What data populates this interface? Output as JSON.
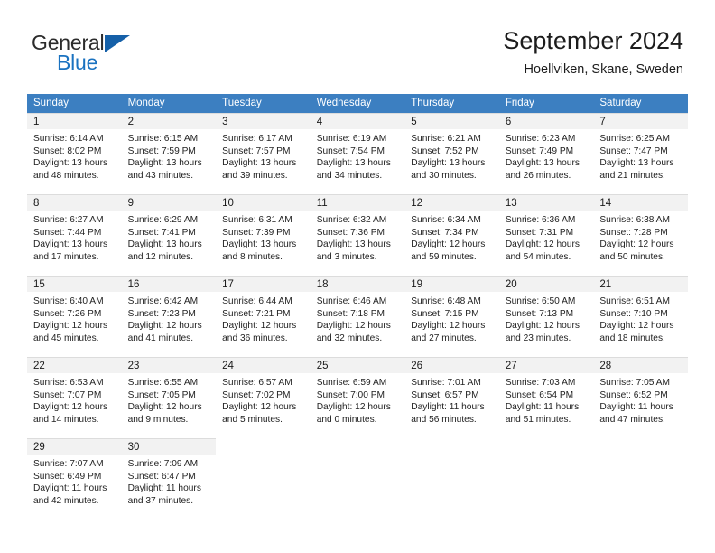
{
  "brand": {
    "name_part1": "General",
    "name_part2": "Blue",
    "flag_icon": "triangle-flag-icon",
    "accent_color": "#1a72c0"
  },
  "header": {
    "month_title": "September 2024",
    "location": "Hoellviken, Skane, Sweden"
  },
  "theme": {
    "header_bg": "#3c7fc1",
    "daynum_bg": "#f2f2f2",
    "grid_line": "#dcdcdc",
    "text": "#1a1a1a"
  },
  "weekday_headers": [
    "Sunday",
    "Monday",
    "Tuesday",
    "Wednesday",
    "Thursday",
    "Friday",
    "Saturday"
  ],
  "weeks": [
    [
      {
        "day": "1",
        "sunrise": "Sunrise: 6:14 AM",
        "sunset": "Sunset: 8:02 PM",
        "daylight1": "Daylight: 13 hours",
        "daylight2": "and 48 minutes."
      },
      {
        "day": "2",
        "sunrise": "Sunrise: 6:15 AM",
        "sunset": "Sunset: 7:59 PM",
        "daylight1": "Daylight: 13 hours",
        "daylight2": "and 43 minutes."
      },
      {
        "day": "3",
        "sunrise": "Sunrise: 6:17 AM",
        "sunset": "Sunset: 7:57 PM",
        "daylight1": "Daylight: 13 hours",
        "daylight2": "and 39 minutes."
      },
      {
        "day": "4",
        "sunrise": "Sunrise: 6:19 AM",
        "sunset": "Sunset: 7:54 PM",
        "daylight1": "Daylight: 13 hours",
        "daylight2": "and 34 minutes."
      },
      {
        "day": "5",
        "sunrise": "Sunrise: 6:21 AM",
        "sunset": "Sunset: 7:52 PM",
        "daylight1": "Daylight: 13 hours",
        "daylight2": "and 30 minutes."
      },
      {
        "day": "6",
        "sunrise": "Sunrise: 6:23 AM",
        "sunset": "Sunset: 7:49 PM",
        "daylight1": "Daylight: 13 hours",
        "daylight2": "and 26 minutes."
      },
      {
        "day": "7",
        "sunrise": "Sunrise: 6:25 AM",
        "sunset": "Sunset: 7:47 PM",
        "daylight1": "Daylight: 13 hours",
        "daylight2": "and 21 minutes."
      }
    ],
    [
      {
        "day": "8",
        "sunrise": "Sunrise: 6:27 AM",
        "sunset": "Sunset: 7:44 PM",
        "daylight1": "Daylight: 13 hours",
        "daylight2": "and 17 minutes."
      },
      {
        "day": "9",
        "sunrise": "Sunrise: 6:29 AM",
        "sunset": "Sunset: 7:41 PM",
        "daylight1": "Daylight: 13 hours",
        "daylight2": "and 12 minutes."
      },
      {
        "day": "10",
        "sunrise": "Sunrise: 6:31 AM",
        "sunset": "Sunset: 7:39 PM",
        "daylight1": "Daylight: 13 hours",
        "daylight2": "and 8 minutes."
      },
      {
        "day": "11",
        "sunrise": "Sunrise: 6:32 AM",
        "sunset": "Sunset: 7:36 PM",
        "daylight1": "Daylight: 13 hours",
        "daylight2": "and 3 minutes."
      },
      {
        "day": "12",
        "sunrise": "Sunrise: 6:34 AM",
        "sunset": "Sunset: 7:34 PM",
        "daylight1": "Daylight: 12 hours",
        "daylight2": "and 59 minutes."
      },
      {
        "day": "13",
        "sunrise": "Sunrise: 6:36 AM",
        "sunset": "Sunset: 7:31 PM",
        "daylight1": "Daylight: 12 hours",
        "daylight2": "and 54 minutes."
      },
      {
        "day": "14",
        "sunrise": "Sunrise: 6:38 AM",
        "sunset": "Sunset: 7:28 PM",
        "daylight1": "Daylight: 12 hours",
        "daylight2": "and 50 minutes."
      }
    ],
    [
      {
        "day": "15",
        "sunrise": "Sunrise: 6:40 AM",
        "sunset": "Sunset: 7:26 PM",
        "daylight1": "Daylight: 12 hours",
        "daylight2": "and 45 minutes."
      },
      {
        "day": "16",
        "sunrise": "Sunrise: 6:42 AM",
        "sunset": "Sunset: 7:23 PM",
        "daylight1": "Daylight: 12 hours",
        "daylight2": "and 41 minutes."
      },
      {
        "day": "17",
        "sunrise": "Sunrise: 6:44 AM",
        "sunset": "Sunset: 7:21 PM",
        "daylight1": "Daylight: 12 hours",
        "daylight2": "and 36 minutes."
      },
      {
        "day": "18",
        "sunrise": "Sunrise: 6:46 AM",
        "sunset": "Sunset: 7:18 PM",
        "daylight1": "Daylight: 12 hours",
        "daylight2": "and 32 minutes."
      },
      {
        "day": "19",
        "sunrise": "Sunrise: 6:48 AM",
        "sunset": "Sunset: 7:15 PM",
        "daylight1": "Daylight: 12 hours",
        "daylight2": "and 27 minutes."
      },
      {
        "day": "20",
        "sunrise": "Sunrise: 6:50 AM",
        "sunset": "Sunset: 7:13 PM",
        "daylight1": "Daylight: 12 hours",
        "daylight2": "and 23 minutes."
      },
      {
        "day": "21",
        "sunrise": "Sunrise: 6:51 AM",
        "sunset": "Sunset: 7:10 PM",
        "daylight1": "Daylight: 12 hours",
        "daylight2": "and 18 minutes."
      }
    ],
    [
      {
        "day": "22",
        "sunrise": "Sunrise: 6:53 AM",
        "sunset": "Sunset: 7:07 PM",
        "daylight1": "Daylight: 12 hours",
        "daylight2": "and 14 minutes."
      },
      {
        "day": "23",
        "sunrise": "Sunrise: 6:55 AM",
        "sunset": "Sunset: 7:05 PM",
        "daylight1": "Daylight: 12 hours",
        "daylight2": "and 9 minutes."
      },
      {
        "day": "24",
        "sunrise": "Sunrise: 6:57 AM",
        "sunset": "Sunset: 7:02 PM",
        "daylight1": "Daylight: 12 hours",
        "daylight2": "and 5 minutes."
      },
      {
        "day": "25",
        "sunrise": "Sunrise: 6:59 AM",
        "sunset": "Sunset: 7:00 PM",
        "daylight1": "Daylight: 12 hours",
        "daylight2": "and 0 minutes."
      },
      {
        "day": "26",
        "sunrise": "Sunrise: 7:01 AM",
        "sunset": "Sunset: 6:57 PM",
        "daylight1": "Daylight: 11 hours",
        "daylight2": "and 56 minutes."
      },
      {
        "day": "27",
        "sunrise": "Sunrise: 7:03 AM",
        "sunset": "Sunset: 6:54 PM",
        "daylight1": "Daylight: 11 hours",
        "daylight2": "and 51 minutes."
      },
      {
        "day": "28",
        "sunrise": "Sunrise: 7:05 AM",
        "sunset": "Sunset: 6:52 PM",
        "daylight1": "Daylight: 11 hours",
        "daylight2": "and 47 minutes."
      }
    ],
    [
      {
        "day": "29",
        "sunrise": "Sunrise: 7:07 AM",
        "sunset": "Sunset: 6:49 PM",
        "daylight1": "Daylight: 11 hours",
        "daylight2": "and 42 minutes."
      },
      {
        "day": "30",
        "sunrise": "Sunrise: 7:09 AM",
        "sunset": "Sunset: 6:47 PM",
        "daylight1": "Daylight: 11 hours",
        "daylight2": "and 37 minutes."
      },
      {
        "day": "",
        "sunrise": "",
        "sunset": "",
        "daylight1": "",
        "daylight2": ""
      },
      {
        "day": "",
        "sunrise": "",
        "sunset": "",
        "daylight1": "",
        "daylight2": ""
      },
      {
        "day": "",
        "sunrise": "",
        "sunset": "",
        "daylight1": "",
        "daylight2": ""
      },
      {
        "day": "",
        "sunrise": "",
        "sunset": "",
        "daylight1": "",
        "daylight2": ""
      },
      {
        "day": "",
        "sunrise": "",
        "sunset": "",
        "daylight1": "",
        "daylight2": ""
      }
    ]
  ]
}
